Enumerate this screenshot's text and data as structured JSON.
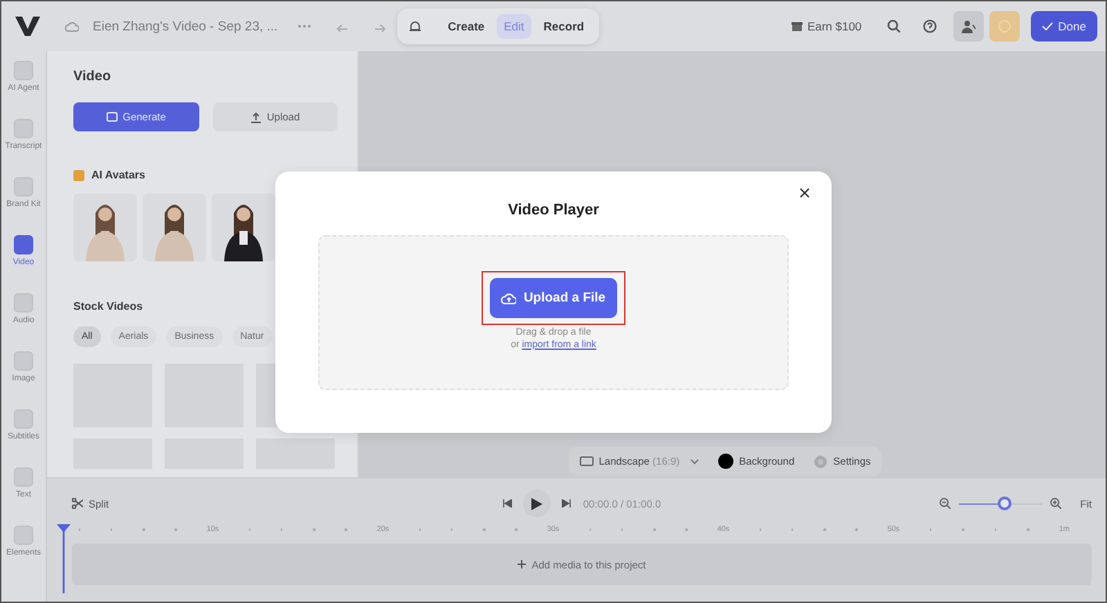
{
  "top_bar": {
    "title": "Eien Zhang's Video - Sep 23, ...",
    "mode_tabs": [
      {
        "label": "Create",
        "selected": false
      },
      {
        "label": "Edit",
        "selected": true
      },
      {
        "label": "Record",
        "selected": false
      }
    ],
    "earn": "Earn $100",
    "done": "Done"
  },
  "sidebar": {
    "items": [
      {
        "label": "AI Agent",
        "selected": false
      },
      {
        "label": "Transcript",
        "selected": false
      },
      {
        "label": "Brand Kit",
        "selected": false
      },
      {
        "label": "Video",
        "selected": true
      },
      {
        "label": "Audio",
        "selected": false
      },
      {
        "label": "Image",
        "selected": false
      },
      {
        "label": "Subtitles",
        "selected": false
      },
      {
        "label": "Text",
        "selected": false
      },
      {
        "label": "Elements",
        "selected": false
      }
    ]
  },
  "panel": {
    "title": "Video",
    "buttons": [
      {
        "label": "Generate",
        "kind": "primary"
      },
      {
        "label": "Upload",
        "kind": "secondary"
      }
    ],
    "avatars_title": "AI Avatars",
    "stock_title": "Stock Videos",
    "filters": [
      {
        "label": "All",
        "selected": true
      },
      {
        "label": "Aerials",
        "selected": false
      },
      {
        "label": "Business",
        "selected": false
      },
      {
        "label": "Natur",
        "selected": false
      }
    ]
  },
  "canvas_toolbar": {
    "aspect": "Landscape",
    "aspect_ratio": "(16:9)",
    "background": "Background",
    "settings": "Settings"
  },
  "timeline": {
    "split": "Split",
    "time": "00:00.0 / 01:00.0",
    "zoom": {
      "level": 0.55
    },
    "fit": "Fit",
    "ticks": [
      "10s",
      "20s",
      "30s",
      "40s",
      "50s",
      "1m"
    ],
    "empty_track": "Add media to this project"
  },
  "modal": {
    "title": "Video Player",
    "upload_button": "Upload a File",
    "drop_hint": "Drag & drop a file",
    "link_prefix": "or",
    "link": "import from a link"
  }
}
